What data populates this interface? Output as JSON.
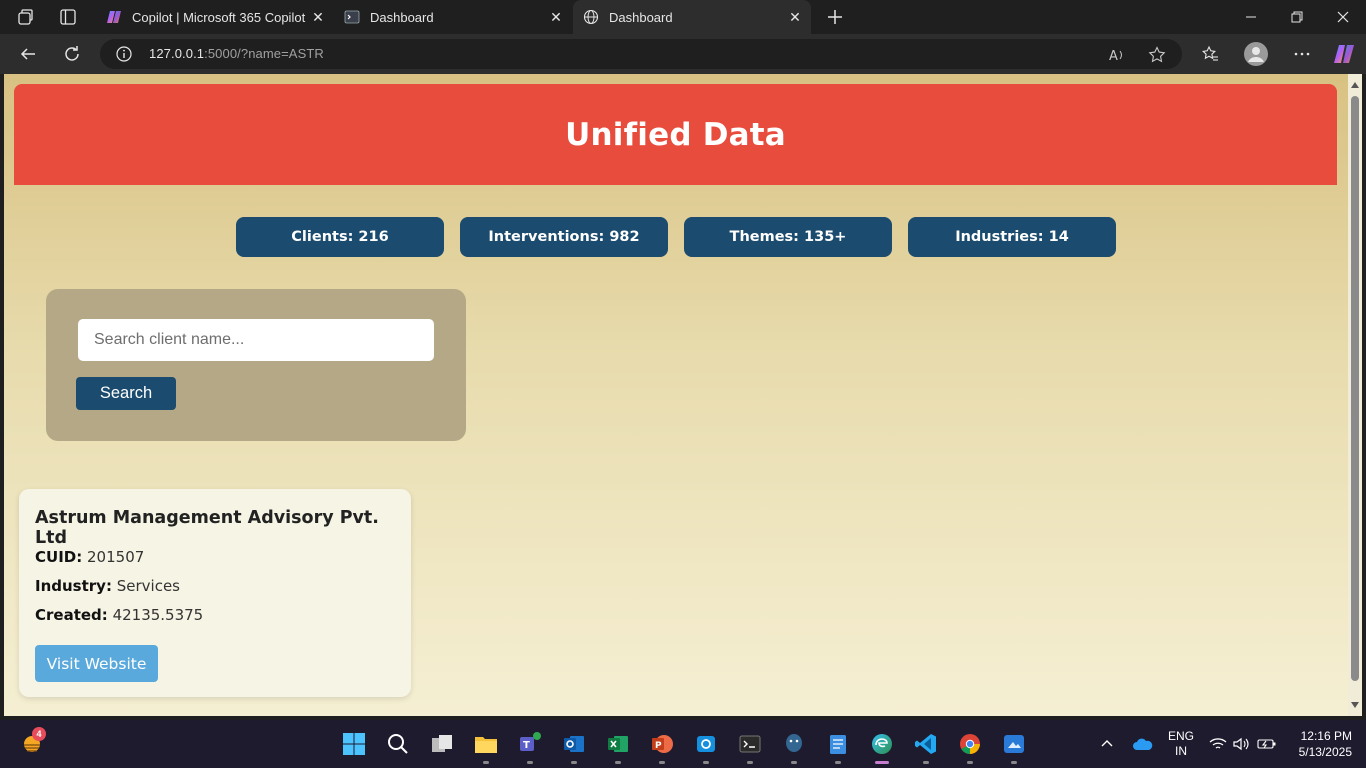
{
  "browser": {
    "tabs": [
      {
        "title": "Copilot | Microsoft 365 Copilot",
        "icon": "copilot-icon"
      },
      {
        "title": "Dashboard",
        "icon": "terminal-icon"
      },
      {
        "title": "Dashboard",
        "icon": "globe-icon",
        "active": true
      }
    ],
    "url_host": "127.0.0.1",
    "url_rest": ":5000/?name=ASTR"
  },
  "page": {
    "title": "Unified Data",
    "stats": [
      {
        "label": "Clients: 216"
      },
      {
        "label": "Interventions: 982"
      },
      {
        "label": "Themes: 135+"
      },
      {
        "label": "Industries: 14"
      }
    ],
    "search": {
      "placeholder": "Search client name...",
      "button_label": "Search"
    },
    "result": {
      "name": "Astrum Management Advisory Pvt. Ltd",
      "cuid_label": "CUID:",
      "cuid": "201507",
      "industry_label": "Industry:",
      "industry": "Services",
      "created_label": "Created:",
      "created": "42135.5375",
      "button_label": "Visit Website"
    },
    "colors": {
      "header": "#e84c3d",
      "stat_bg": "#1b4b6e",
      "visit_btn": "#5aa9dc"
    }
  },
  "taskbar": {
    "notification_count": "4",
    "language": "ENG",
    "region": "IN",
    "time": "12:16 PM",
    "date": "5/13/2025"
  }
}
